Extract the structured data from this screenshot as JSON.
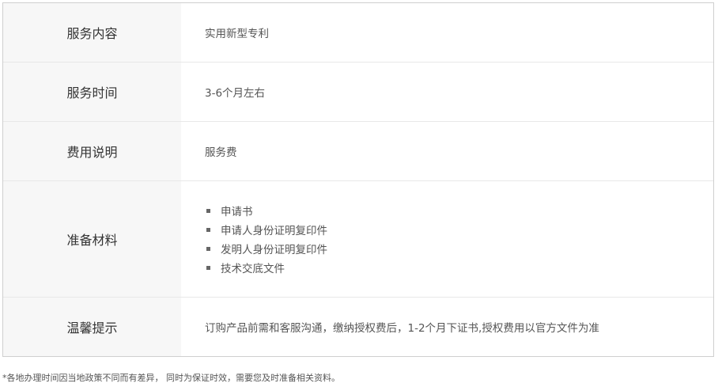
{
  "rows": [
    {
      "label": "服务内容",
      "value": "实用新型专利"
    },
    {
      "label": "服务时间",
      "value": "3-6个月左右"
    },
    {
      "label": "费用说明",
      "value": "服务费"
    },
    {
      "label": "准备材料",
      "items": [
        "申请书",
        "申请人身份证明复印件",
        "发明人身份证明复印件",
        "技术交底文件"
      ]
    },
    {
      "label": "温馨提示",
      "value": "订购产品前需和客服沟通，缴纳授权费后，1-2个月下证书,授权费用以官方文件为准"
    }
  ],
  "footnote": "*各地办理时间因当地政策不同而有差异， 同时为保证时效，需要您及时准备相关资料。"
}
